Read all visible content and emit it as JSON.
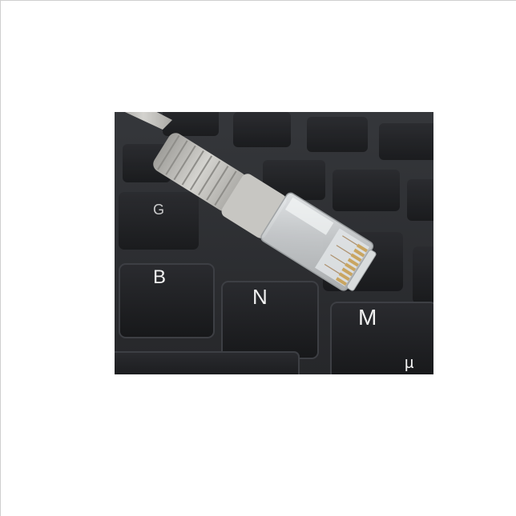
{
  "photo": {
    "subject": "ethernet-cable-on-keyboard",
    "keys": {
      "b": "B",
      "n": "N",
      "m": "M",
      "mu": "µ",
      "g": "G"
    },
    "colors": {
      "keyboard_base": "#2b2c30",
      "key_top": "#1d1e21",
      "key_edge": "#3c3e43",
      "cable": "#bdbcb8",
      "connector": "#d8dadb",
      "contact_gold": "#c9a561"
    }
  }
}
